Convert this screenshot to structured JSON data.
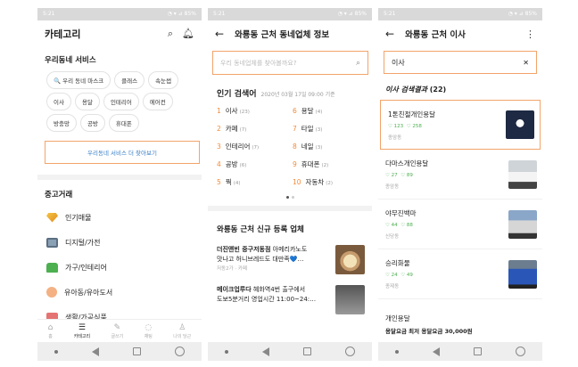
{
  "status": {
    "time": "5:21",
    "icons": "◔ ▾ ⊿ 85%"
  },
  "phone1": {
    "title": "카테고리",
    "section1": "우리동네 서비스",
    "chips": [
      "🔍 우리 동네 마스크",
      "클래스",
      "속눈썹",
      "이사",
      "용달",
      "인테리어",
      "에어컨",
      "방충망",
      "공방",
      "휴대폰"
    ],
    "more": "우리동네 서비스 더 찾아보기",
    "section2": "중고거래",
    "categories": [
      "인기매물",
      "디지털/가전",
      "가구/인테리어",
      "유아동/유아도서",
      "생활/가공식품"
    ],
    "tabs": [
      "홈",
      "카테고리",
      "글쓰기",
      "채팅",
      "나의 당근"
    ]
  },
  "phone2": {
    "title": "와룡동 근처 동네업체 정보",
    "search_placeholder": "우리 동네업체를 찾아볼까요?",
    "popular_title": "인기 검색어",
    "popular_date": "2020년 03월 17일 09:00 기준",
    "ranks": [
      {
        "n": "1",
        "k": "이사",
        "c": "(23)"
      },
      {
        "n": "6",
        "k": "용달",
        "c": "(4)"
      },
      {
        "n": "2",
        "k": "카페",
        "c": "(7)"
      },
      {
        "n": "7",
        "k": "타일",
        "c": "(3)"
      },
      {
        "n": "3",
        "k": "인테리어",
        "c": "(7)"
      },
      {
        "n": "8",
        "k": "네일",
        "c": "(3)"
      },
      {
        "n": "4",
        "k": "공방",
        "c": "(6)"
      },
      {
        "n": "9",
        "k": "휴대폰",
        "c": "(2)"
      },
      {
        "n": "5",
        "k": "꿕",
        "c": "(4)"
      },
      {
        "n": "10",
        "k": "자동차",
        "c": "(2)"
      }
    ],
    "new_title": "와룡동 근처 신규 등록 업체",
    "biz": [
      {
        "name": "더진앤빈 중구저동점",
        "desc": "아메리카노도",
        "desc2": "맛나고 허니브레드도 대만족💙…",
        "sub": "저동2가 · 카페"
      },
      {
        "name": "메이크업루다",
        "desc": "혜화역4번 출구에서",
        "desc2": "도보5분거리 영업시간 11:00~24:…",
        "sub": ""
      }
    ]
  },
  "phone3": {
    "title": "와룡동 근처 이사",
    "query": "이사",
    "result_label": "이사 검색결과",
    "result_count": "(22)",
    "results": [
      {
        "name": "1톤친절개인용달",
        "likes": "♡ 123",
        "hearts": "♡ 258",
        "loc": "종암동"
      },
      {
        "name": "다마스개인용달",
        "likes": "♡ 27",
        "hearts": "♡ 89",
        "loc": "종암동"
      },
      {
        "name": "야무진백마",
        "likes": "♡ 44",
        "hearts": "♡ 88",
        "loc": "신당동"
      },
      {
        "name": "승리화물",
        "likes": "♡ 24",
        "hearts": "♡ 49",
        "loc": "종제동"
      }
    ],
    "last_name": "개인용달",
    "last_desc": "용달요금 최저 용달요금 30,000원"
  }
}
